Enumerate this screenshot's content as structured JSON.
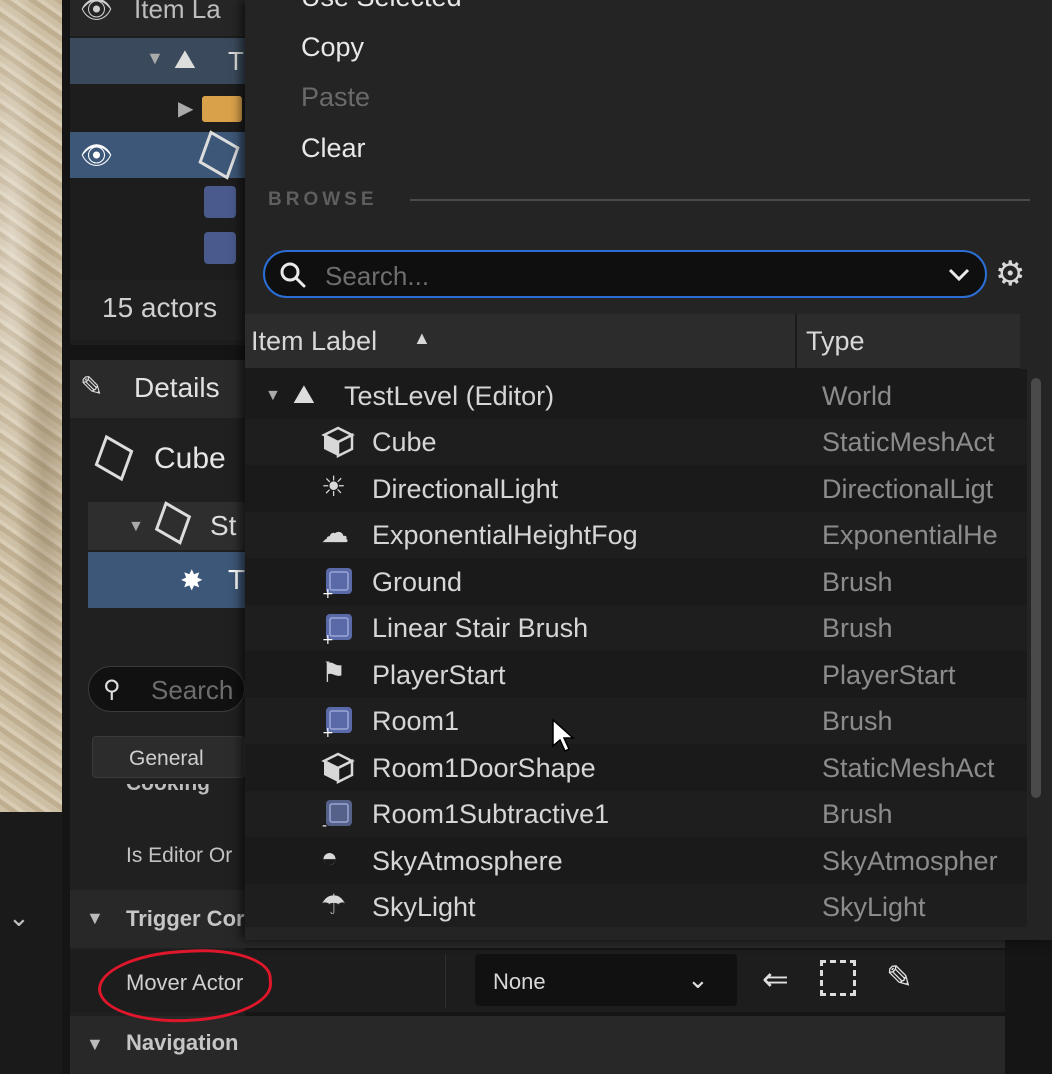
{
  "outliner": {
    "header_label": "Item La",
    "row_label_partial": "T",
    "actor_count": "15 actors"
  },
  "details": {
    "tab_label": "Details",
    "actor_name": "Cube",
    "component_partial": "St",
    "component2_partial": "T",
    "search_placeholder": "Search",
    "category_button": "General",
    "cooking_label": "Cooking",
    "is_editor_only_label": "Is Editor Or",
    "trigger_section": "Trigger Cor",
    "mover_actor_label": "Mover Actor",
    "mover_actor_value": "None",
    "navigation_section": "Navigation"
  },
  "menu": {
    "items": [
      {
        "label": "Use Selected",
        "disabled": false
      },
      {
        "label": "Copy",
        "disabled": false
      },
      {
        "label": "Paste",
        "disabled": true
      },
      {
        "label": "Clear",
        "disabled": false
      }
    ],
    "browse_heading": "BROWSE",
    "search_placeholder": "Search...",
    "columns": {
      "label": "Item Label",
      "type": "Type"
    },
    "root": {
      "label": "TestLevel (Editor)",
      "type": "World",
      "icon": "level-icon"
    },
    "actors": [
      {
        "label": "Cube",
        "type": "StaticMeshAct",
        "icon": "static-mesh-icon"
      },
      {
        "label": "DirectionalLight",
        "type": "DirectionalLigt",
        "icon": "directional-light-icon"
      },
      {
        "label": "ExponentialHeightFog",
        "type": "ExponentialHe",
        "icon": "fog-icon"
      },
      {
        "label": "Ground",
        "type": "Brush",
        "icon": "brush-icon"
      },
      {
        "label": "Linear Stair Brush",
        "type": "Brush",
        "icon": "brush-icon"
      },
      {
        "label": "PlayerStart",
        "type": "PlayerStart",
        "icon": "player-start-icon"
      },
      {
        "label": "Room1",
        "type": "Brush",
        "icon": "brush-icon"
      },
      {
        "label": "Room1DoorShape",
        "type": "StaticMeshAct",
        "icon": "static-mesh-icon"
      },
      {
        "label": "Room1Subtractive1",
        "type": "Brush",
        "icon": "brush-subtractive-icon"
      },
      {
        "label": "SkyAtmosphere",
        "type": "SkyAtmospher",
        "icon": "sky-atmosphere-icon"
      },
      {
        "label": "SkyLight",
        "type": "SkyLight",
        "icon": "sky-light-icon"
      }
    ]
  },
  "colors": {
    "accent": "#2b6fd6",
    "selection": "#3d5778",
    "annotation": "#e0162b"
  }
}
